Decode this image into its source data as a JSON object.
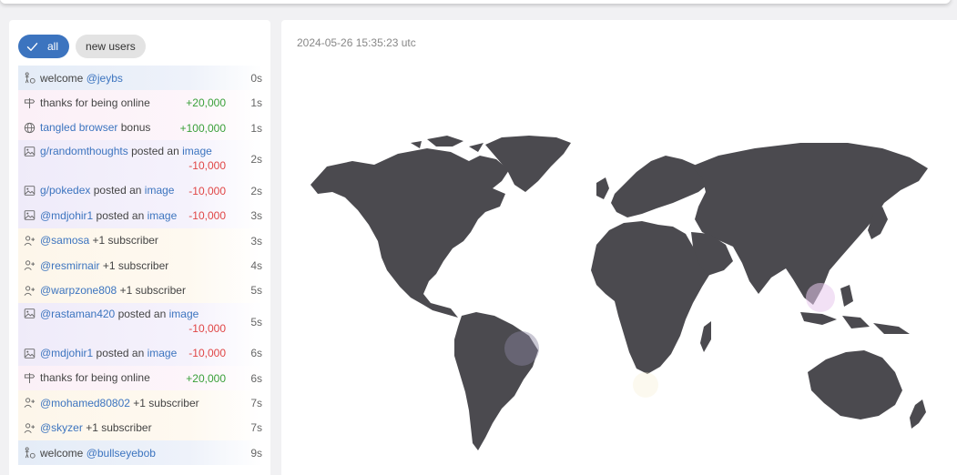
{
  "filters": {
    "all": "all",
    "new_users": "new users"
  },
  "timestamp": "2024-05-26 15:35:23 utc",
  "colors": {
    "accent": "#3c74bf",
    "positive": "#3aa03a",
    "negative": "#e04646",
    "map_land": "#4b4a4f"
  },
  "feed": [
    {
      "icon": "welcome-icon",
      "bg": "blue",
      "parts": [
        {
          "t": "welcome "
        },
        {
          "t": "@jeybs",
          "link": true
        }
      ],
      "amount": "",
      "time": "0s"
    },
    {
      "icon": "signpost-icon",
      "bg": "pink",
      "parts": [
        {
          "t": "thanks for being online"
        }
      ],
      "amount": "+20,000",
      "time": "1s"
    },
    {
      "icon": "globe-icon",
      "bg": "pink",
      "parts": [
        {
          "t": "tangled browser",
          "link": true
        },
        {
          "t": " bonus"
        }
      ],
      "amount": "+100,000",
      "time": "1s"
    },
    {
      "icon": "image-icon",
      "bg": "purple",
      "tall": true,
      "parts": [
        {
          "t": "g/randomthoughts",
          "link": true
        },
        {
          "t": " posted an "
        },
        {
          "t": "image",
          "link": true
        }
      ],
      "amount": "-10,000",
      "time": "2s"
    },
    {
      "icon": "image-icon",
      "bg": "purple",
      "parts": [
        {
          "t": "g/pokedex",
          "link": true
        },
        {
          "t": " posted an "
        },
        {
          "t": "image",
          "link": true
        }
      ],
      "amount": "-10,000",
      "time": "2s"
    },
    {
      "icon": "image-icon",
      "bg": "purple",
      "parts": [
        {
          "t": "@mdjohir1",
          "link": true
        },
        {
          "t": " posted an "
        },
        {
          "t": "image",
          "link": true
        }
      ],
      "amount": "-10,000",
      "time": "3s"
    },
    {
      "icon": "add-user-icon",
      "bg": "yellow",
      "parts": [
        {
          "t": "@samosa",
          "link": true
        },
        {
          "t": " +1 subscriber"
        }
      ],
      "amount": "",
      "time": "3s"
    },
    {
      "icon": "add-user-icon",
      "bg": "yellow",
      "parts": [
        {
          "t": "@resmirnair",
          "link": true
        },
        {
          "t": " +1 subscriber"
        }
      ],
      "amount": "",
      "time": "4s"
    },
    {
      "icon": "add-user-icon",
      "bg": "yellow",
      "parts": [
        {
          "t": "@warpzone808",
          "link": true
        },
        {
          "t": " +1 subscriber"
        }
      ],
      "amount": "",
      "time": "5s"
    },
    {
      "icon": "image-icon",
      "bg": "purple",
      "tall": true,
      "parts": [
        {
          "t": "@rastaman420",
          "link": true
        },
        {
          "t": " posted an "
        },
        {
          "t": "image",
          "link": true
        }
      ],
      "amount": "-10,000",
      "time": "5s"
    },
    {
      "icon": "image-icon",
      "bg": "purple",
      "parts": [
        {
          "t": "@mdjohir1",
          "link": true
        },
        {
          "t": " posted an "
        },
        {
          "t": "image",
          "link": true
        }
      ],
      "amount": "-10,000",
      "time": "6s"
    },
    {
      "icon": "signpost-icon",
      "bg": "pink",
      "parts": [
        {
          "t": "thanks for being online"
        }
      ],
      "amount": "+20,000",
      "time": "6s"
    },
    {
      "icon": "add-user-icon",
      "bg": "yellow",
      "parts": [
        {
          "t": "@mohamed80802",
          "link": true
        },
        {
          "t": " +1 subscriber"
        }
      ],
      "amount": "",
      "time": "7s"
    },
    {
      "icon": "add-user-icon",
      "bg": "yellow",
      "parts": [
        {
          "t": "@skyzer",
          "link": true
        },
        {
          "t": " +1 subscriber"
        }
      ],
      "amount": "",
      "time": "7s"
    },
    {
      "icon": "welcome-icon",
      "bg": "blue",
      "parts": [
        {
          "t": "welcome "
        },
        {
          "t": "@bullseyebob",
          "link": true
        }
      ],
      "amount": "",
      "time": "9s"
    }
  ]
}
